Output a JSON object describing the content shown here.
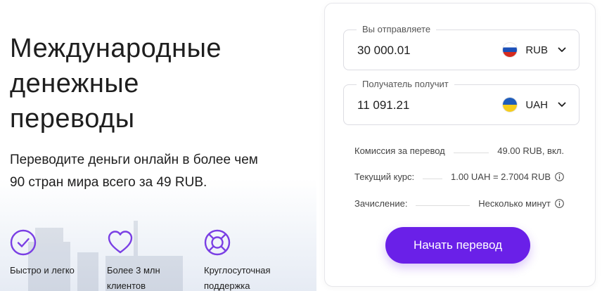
{
  "hero": {
    "title": "Международные\nденежные\nпереводы",
    "subtitle": "Переводите деньги онлайн в более чем\n90 стран мира всего за 49 RUB."
  },
  "features": [
    {
      "label": "Быстро и легко",
      "icon": "check-circle-icon"
    },
    {
      "label": "Более 3 млн\nклиентов",
      "icon": "heart-icon"
    },
    {
      "label": "Круглосуточная\nподдержка",
      "icon": "lifebuoy-icon"
    }
  ],
  "calculator": {
    "send": {
      "label": "Вы отправляете",
      "amount": "30 000.01",
      "currency": "RUB",
      "flag": "russia-flag-icon"
    },
    "receive": {
      "label": "Получатель получит",
      "amount": "11 091.21",
      "currency": "UAH",
      "flag": "ukraine-flag-icon"
    },
    "info": [
      {
        "label": "Комиссия за перевод",
        "value": "49.00 RUB, вкл."
      },
      {
        "label": "Текущий курс:",
        "value": "1.00 UAH = 2.7004 RUB"
      },
      {
        "label": "Зачисление:",
        "value": "Несколько минут"
      }
    ],
    "button_label": "Начать перевод"
  },
  "colors": {
    "accent": "#6a20e8",
    "feature_icon": "#7a3fe4",
    "text": "#1e1e1e"
  }
}
